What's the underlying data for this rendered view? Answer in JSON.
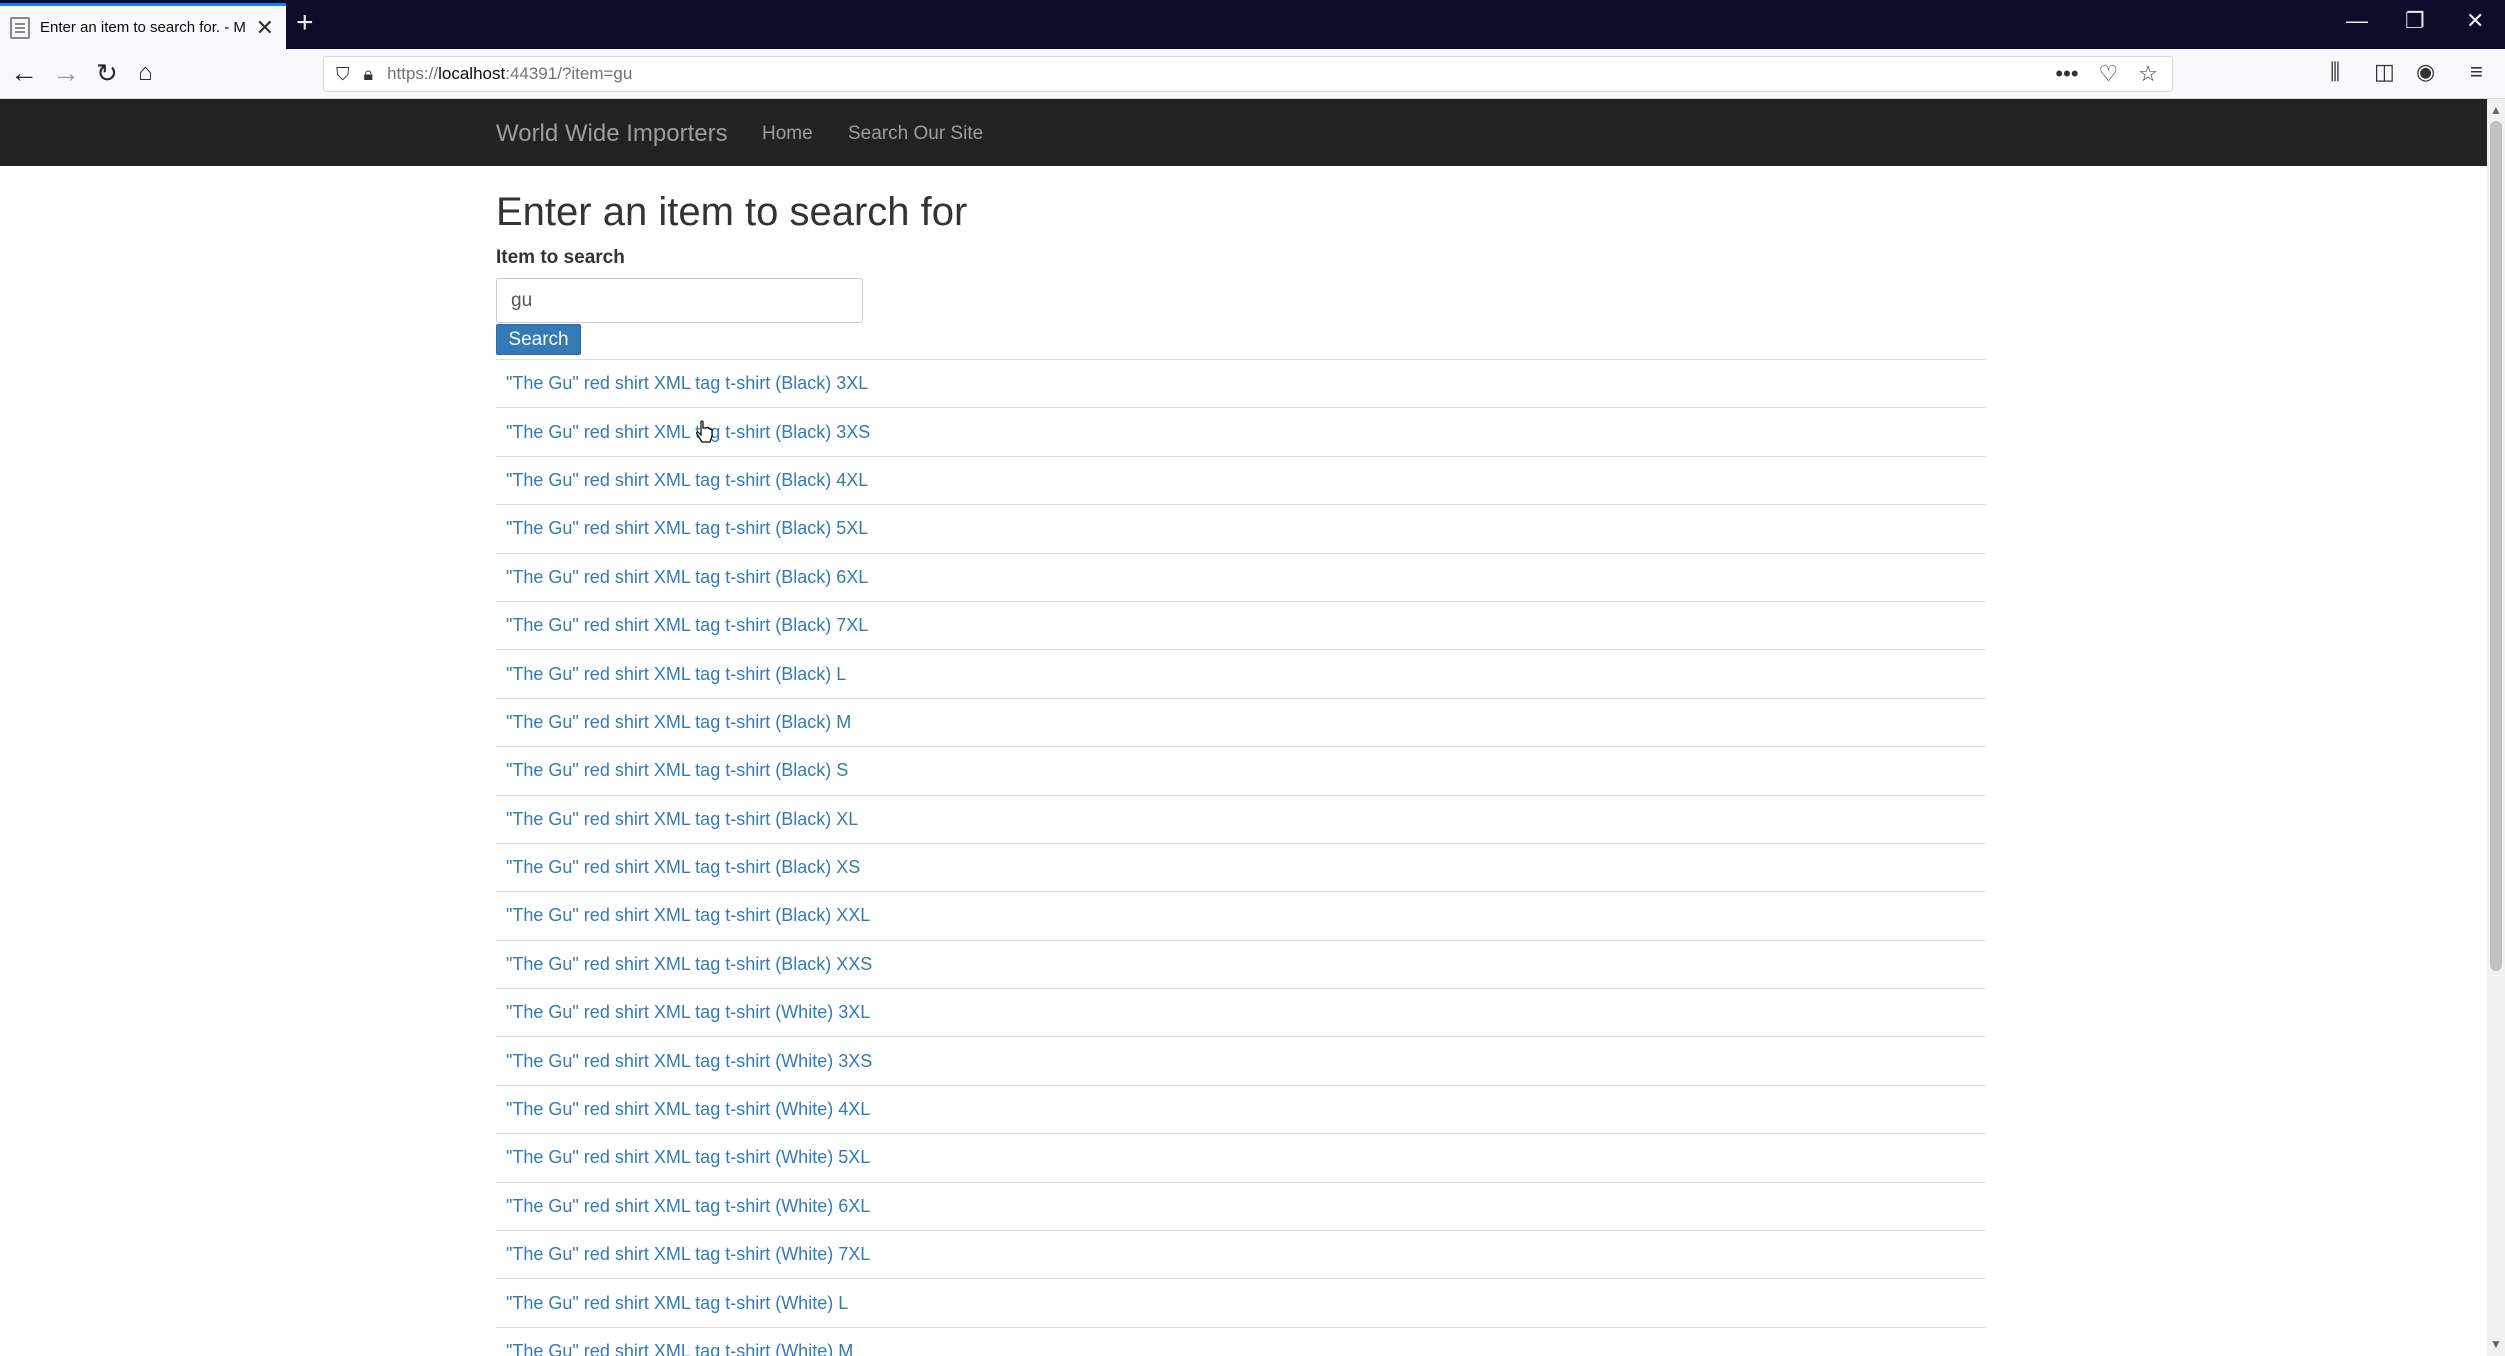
{
  "browser": {
    "tab_title": "Enter an item to search for. - M",
    "new_tab": "+",
    "url_prefix": "https://",
    "url_host": "localhost",
    "url_rest": ":44391/?item=gu"
  },
  "navbar": {
    "brand": "World Wide Importers",
    "links": [
      "Home",
      "Search Our Site"
    ]
  },
  "page": {
    "heading": "Enter an item to search for",
    "field_label": "Item to search",
    "input_value": "gu",
    "button_label": "Search"
  },
  "results": [
    "\"The Gu\" red shirt XML tag t-shirt (Black) 3XL",
    "\"The Gu\" red shirt XML tag t-shirt (Black) 3XS",
    "\"The Gu\" red shirt XML tag t-shirt (Black) 4XL",
    "\"The Gu\" red shirt XML tag t-shirt (Black) 5XL",
    "\"The Gu\" red shirt XML tag t-shirt (Black) 6XL",
    "\"The Gu\" red shirt XML tag t-shirt (Black) 7XL",
    "\"The Gu\" red shirt XML tag t-shirt (Black) L",
    "\"The Gu\" red shirt XML tag t-shirt (Black) M",
    "\"The Gu\" red shirt XML tag t-shirt (Black) S",
    "\"The Gu\" red shirt XML tag t-shirt (Black) XL",
    "\"The Gu\" red shirt XML tag t-shirt (Black) XS",
    "\"The Gu\" red shirt XML tag t-shirt (Black) XXL",
    "\"The Gu\" red shirt XML tag t-shirt (Black) XXS",
    "\"The Gu\" red shirt XML tag t-shirt (White) 3XL",
    "\"The Gu\" red shirt XML tag t-shirt (White) 3XS",
    "\"The Gu\" red shirt XML tag t-shirt (White) 4XL",
    "\"The Gu\" red shirt XML tag t-shirt (White) 5XL",
    "\"The Gu\" red shirt XML tag t-shirt (White) 6XL",
    "\"The Gu\" red shirt XML tag t-shirt (White) 7XL",
    "\"The Gu\" red shirt XML tag t-shirt (White) L",
    "\"The Gu\" red shirt XML tag t-shirt (White) M"
  ],
  "colors": {
    "navbar_bg": "#222222",
    "link": "#337ab7",
    "button": "#337ab7",
    "tab_accent": "#0a84ff"
  }
}
